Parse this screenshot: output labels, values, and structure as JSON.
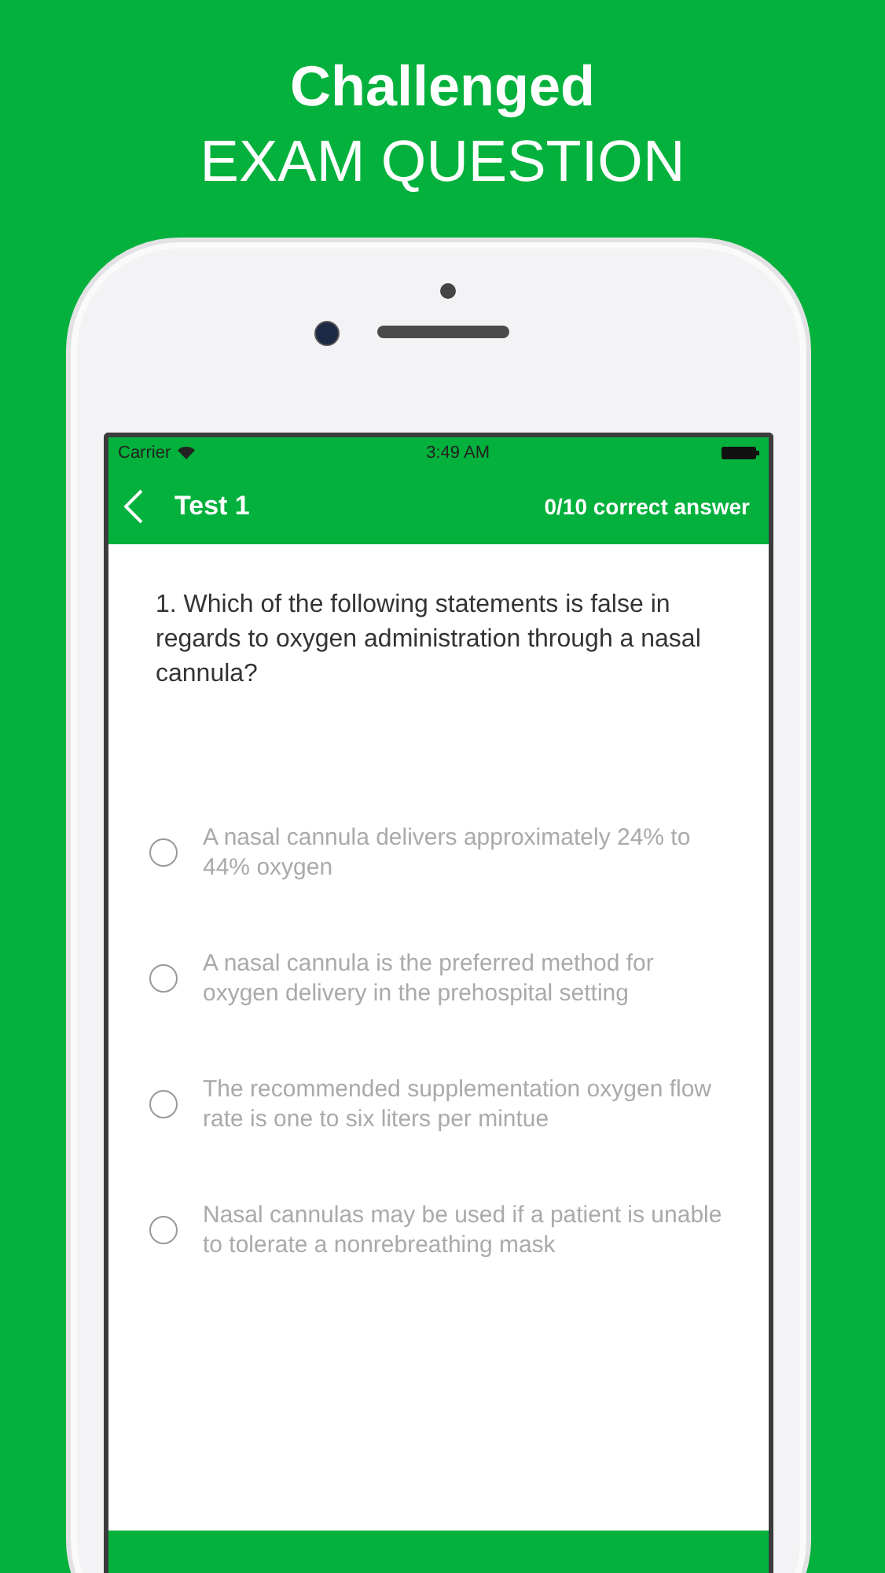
{
  "headline": [
    "Challenged",
    "EXAM QUESTION"
  ],
  "status_bar": {
    "carrier": "Carrier",
    "time": "3:49 AM"
  },
  "nav": {
    "title": "Test 1",
    "score": "0/10 correct answer"
  },
  "question": "1. Which of the following statements is false in regards to oxygen administration through a nasal cannula?",
  "options": [
    {
      "text": "A nasal cannula delivers approximately 24% to 44% oxygen",
      "selected": false
    },
    {
      "text": "A nasal cannula is the preferred method for oxygen delivery in the prehospital setting",
      "selected": false
    },
    {
      "text": "The recommended supplementation oxygen flow rate is one to six liters per mintue",
      "selected": false
    },
    {
      "text": "Nasal cannulas may be used if a patient is unable to tolerate a nonrebreathing mask",
      "selected": false
    }
  ]
}
